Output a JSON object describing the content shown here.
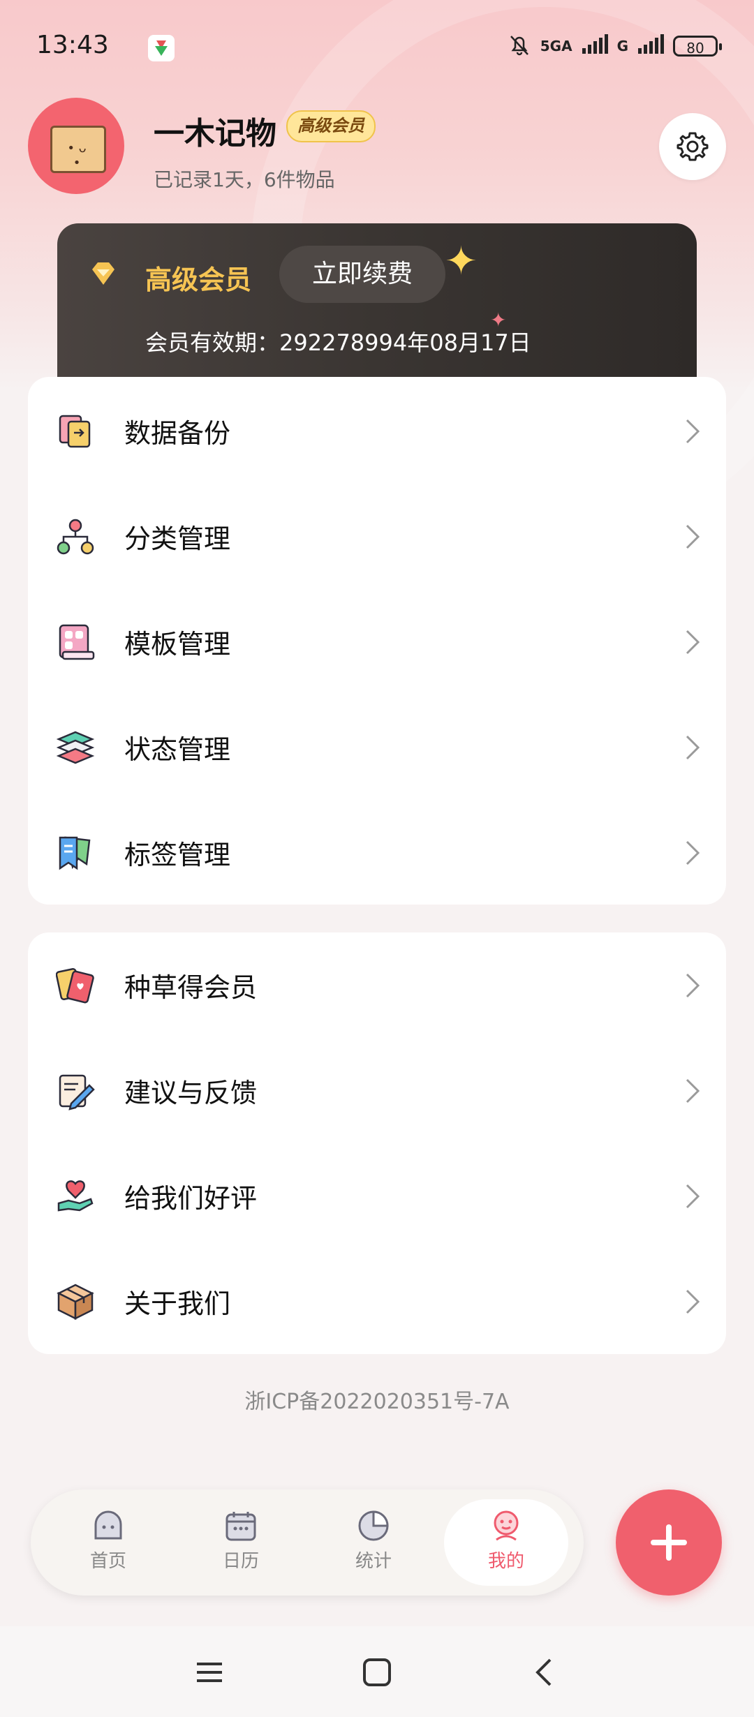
{
  "status_bar": {
    "time": "13:43",
    "network_1": "5GA",
    "network_2": "G",
    "battery": "80",
    "icons": [
      "mute-bell-icon",
      "signal-icon",
      "battery-icon"
    ]
  },
  "profile": {
    "name": "一木记物",
    "badge": "高级会员",
    "subtitle": "已记录1天，6件物品"
  },
  "membership": {
    "level": "高级会员",
    "renew_label": "立即续费",
    "expiry": "会员有效期：292278994年08月17日",
    "accent": "#f6c453"
  },
  "menu_group_1": [
    {
      "label": "数据备份",
      "icon": "data-backup-icon"
    },
    {
      "label": "分类管理",
      "icon": "category-icon"
    },
    {
      "label": "模板管理",
      "icon": "template-icon"
    },
    {
      "label": "状态管理",
      "icon": "layers-icon"
    },
    {
      "label": "标签管理",
      "icon": "tag-icon"
    }
  ],
  "menu_group_2": [
    {
      "label": "种草得会员",
      "icon": "cards-icon"
    },
    {
      "label": "建议与反馈",
      "icon": "feedback-icon"
    },
    {
      "label": "给我们好评",
      "icon": "heart-hand-icon"
    },
    {
      "label": "关于我们",
      "icon": "box-icon"
    }
  ],
  "icp": "浙ICP备2022020351号-7A",
  "tabs": [
    {
      "label": "首页",
      "icon": "home-icon",
      "active": false
    },
    {
      "label": "日历",
      "icon": "calendar-icon",
      "active": false
    },
    {
      "label": "统计",
      "icon": "stats-icon",
      "active": false
    },
    {
      "label": "我的",
      "icon": "profile-icon",
      "active": true
    }
  ],
  "colors": {
    "primary": "#f0606d",
    "gold": "#f6c453"
  }
}
